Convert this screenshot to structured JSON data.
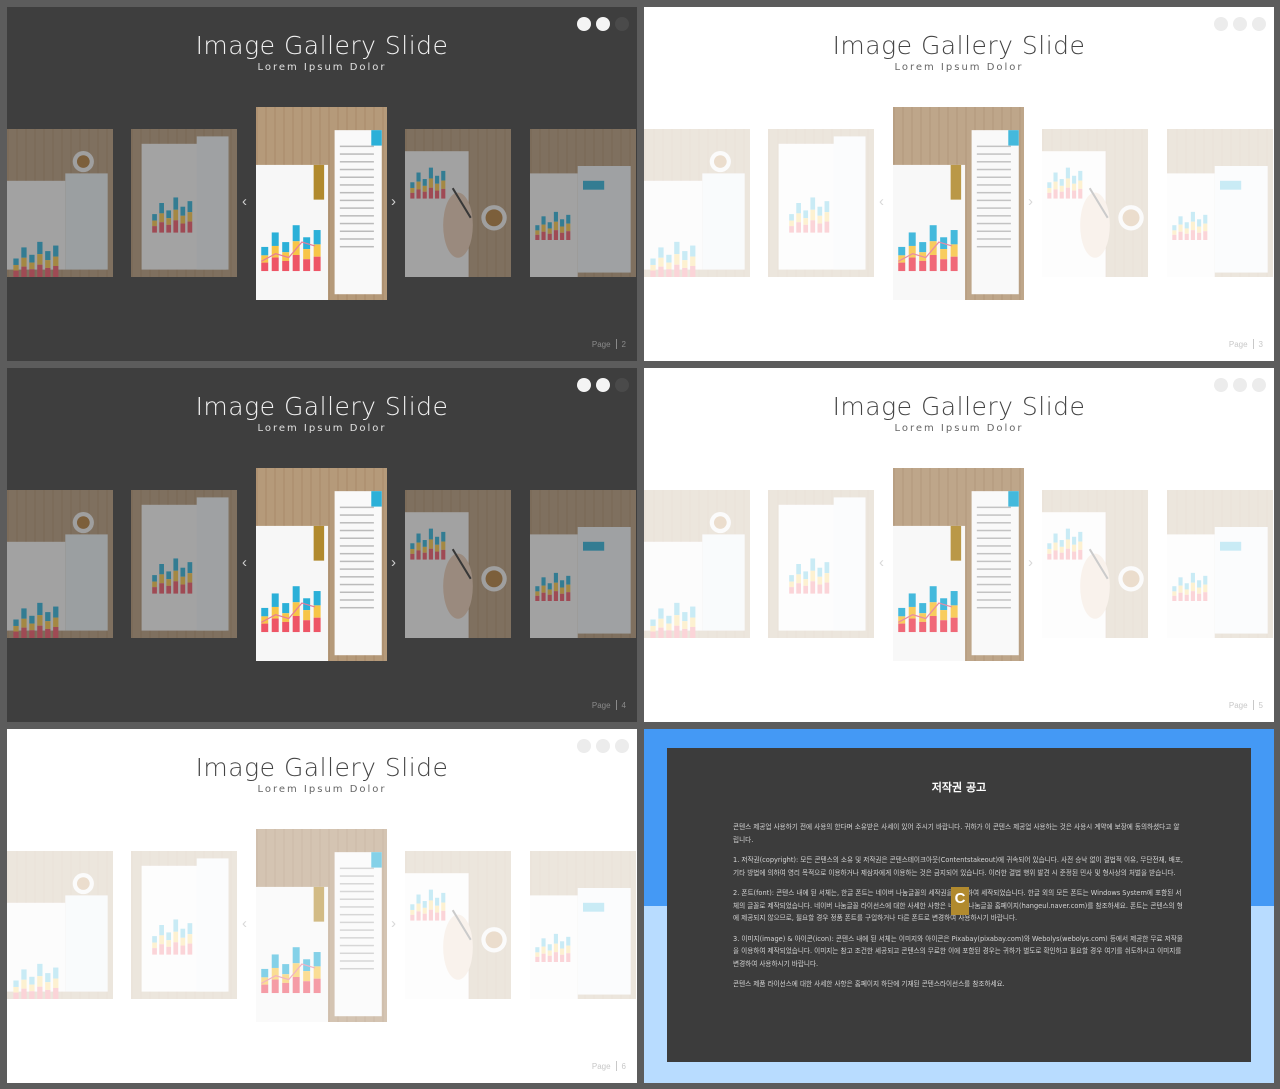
{
  "colors": {
    "dark_slide": "#3e3e3e",
    "light_slide": "#ffffff",
    "bar_teal": "#2bb0d8",
    "bar_yellow": "#f7c548",
    "bar_red": "#ee5566",
    "bar_pink": "#e87b9a",
    "brand_gold": "#b18a2e",
    "blue_band": "#4499f5",
    "light_blue_band": "#b8dcff"
  },
  "gallery": {
    "title": "Image Gallery Slide",
    "subtitle": "Lorem Ipsum Dolor",
    "page_label": "Page",
    "arrow_left": "‹",
    "arrow_right": "›",
    "icons": [
      "pinterest-icon",
      "instagram-icon",
      "facebook-icon"
    ],
    "images": [
      "desk-coffee-chart-photo",
      "chart-paper-photo",
      "desk-report-photo",
      "hand-pen-chart-photo",
      "coffee-document-photo"
    ]
  },
  "slides": [
    {
      "page": "2"
    },
    {
      "page": "3"
    },
    {
      "page": "4"
    },
    {
      "page": "5"
    },
    {
      "page": "6"
    }
  ],
  "copyright": {
    "title": "저작권 공고",
    "p1": "콘텐스 제공업 사용하기 전에 사용의 한다며 소유받은 사세이 있어 주시기 바랍니다. 귀하가 이 콘텐스 제공업 사용하는 것은 사용시 계약에 보장에 동의하셨다고 알립니다.",
    "p2": "1. 저작권(copyright): 모든 콘텐스의 소유 및 저작권은 콘텐스테이크아웃(Contentstakeout)에 귀속되어 있습니다. 사전 승낙 없이 결법적 이유, 무단전재, 배포, 기타 방법에 의하여 영리 목적으로 이용하거나 제삼자에게 이용하는 것은 금지되어 있습니다. 이러한 결법 행위 발견 시 준정된 민사 및 형사상의 처벌을 받습니다.",
    "p3": "2. 폰트(font): 콘텐스 내에 된 서체는, 한글 폰트는 네이버 나눔글꼴의 세작권을 사용하여 세작되었습니다. 한글 외의 모든 폰트는 Windows System에 포함된 서체의 글꼴로 제작되었습니다. 네이버 나눔글꼴 라이선스에 대한 사세한 사항은 네이버 나눔글꼴 홈페이지(hangeul.naver.com)를 참조하세요. 폰트는 콘텐스의 형에 제공되지 않으므로, 필요할 경우 정품 폰트를 구입하거나 다른 폰트로 변경하여 사용하시기 바랍니다.",
    "p4": "3. 이미지(image) & 아이콘(icon): 콘텐스 내에 된 서체는 이미지와 아이콘은 Pixabay(pixabay.com)와 Webolys(webolys.com) 등에서 제공한 무료 저작물을 이용하여 제작되었습니다. 이미지는 참고 조건한 세공되고 콘텐스의 무료한 이에 포함된 경우는 귀하가 별도로 확인하고 필요할 경우 여기를 쉬도하시고 이미지를 변경하여 사용하시기 바랍니다.",
    "p5": "콘텐스 제품 라이선스에 대한 사세한 사항은 홈페이지 하단에 기재된 콘텐스라이선스를 참조하세요.",
    "logo_letter": "C"
  }
}
